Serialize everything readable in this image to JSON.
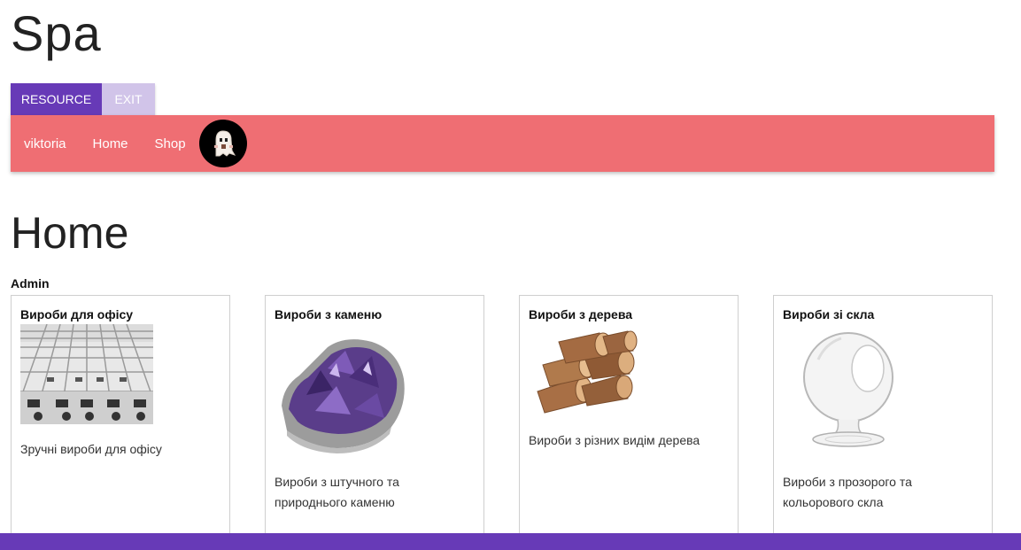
{
  "app": {
    "title": "Spa"
  },
  "toolbar": {
    "resource_label": "RESOURCE",
    "exit_label": "EXIT"
  },
  "nav": {
    "items": [
      {
        "label": "viktoria"
      },
      {
        "label": "Home"
      },
      {
        "label": "Shop"
      }
    ],
    "avatar_icon": "ghost-avatar-icon"
  },
  "main": {
    "title": "Home",
    "role": "Admin",
    "cards": [
      {
        "title": "Вироби для офісу",
        "description": "Зручні вироби для офісу",
        "image": "office-cubicles-image"
      },
      {
        "title": "Вироби з каменю",
        "description": "Вироби з штучного та природнього каменю",
        "image": "amethyst-stone-image"
      },
      {
        "title": "Вироби з дерева",
        "description": "Вироби з різних видім дерева",
        "image": "firewood-logs-image"
      },
      {
        "title": "Вироби зі скла",
        "description": "Вироби з прозорого та кольорового скла",
        "image": "glass-globe-image"
      }
    ]
  },
  "colors": {
    "primary": "#673ab7",
    "primary_light": "#d1c4e9",
    "navbar": "#ef6e73"
  }
}
